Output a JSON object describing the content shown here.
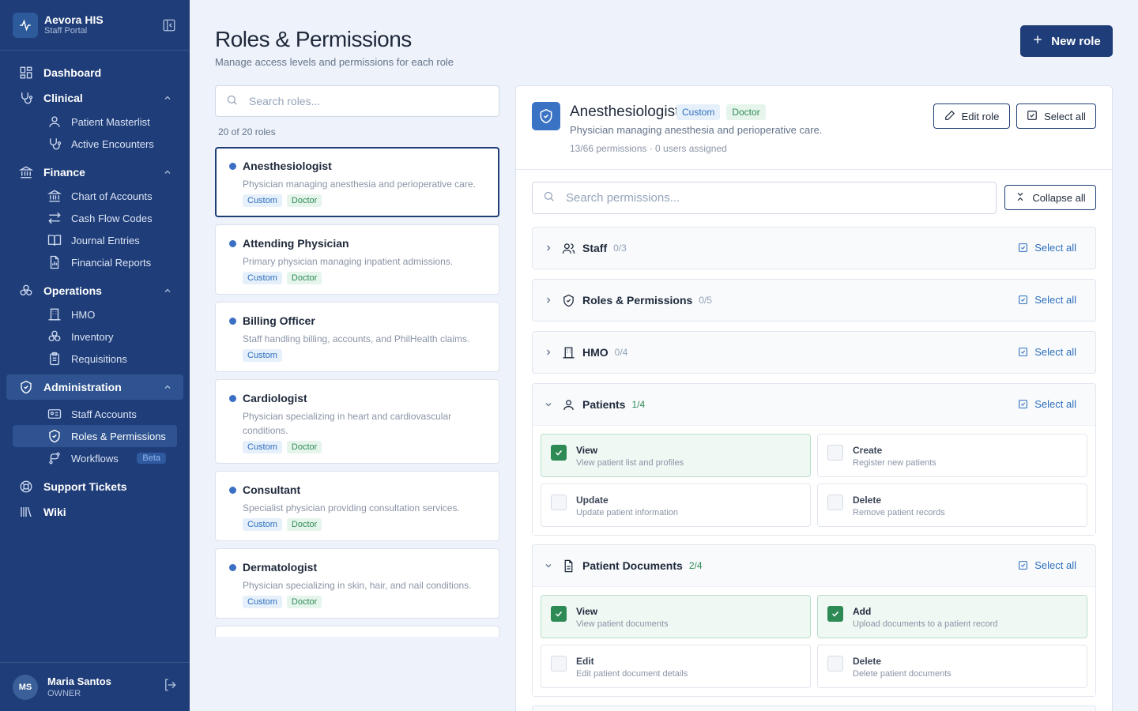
{
  "app": {
    "title": "Aevora HIS",
    "subtitle": "Staff Portal"
  },
  "sidebar": {
    "dashboard": "Dashboard",
    "clinical": {
      "label": "Clinical",
      "items": [
        "Patient Masterlist",
        "Active Encounters"
      ]
    },
    "finance": {
      "label": "Finance",
      "items": [
        "Chart of Accounts",
        "Cash Flow Codes",
        "Journal Entries",
        "Financial Reports"
      ]
    },
    "operations": {
      "label": "Operations",
      "items": [
        "HMO",
        "Inventory",
        "Requisitions"
      ]
    },
    "administration": {
      "label": "Administration",
      "items": [
        "Staff Accounts",
        "Roles & Permissions",
        "Workflows"
      ],
      "beta": "Beta"
    },
    "support": "Support Tickets",
    "wiki": "Wiki"
  },
  "user": {
    "initials": "MS",
    "name": "Maria Santos",
    "role": "OWNER"
  },
  "page": {
    "title": "Roles & Permissions",
    "subtitle": "Manage access levels and permissions for each role",
    "new_role": "New role"
  },
  "roles": {
    "search_placeholder": "Search roles...",
    "count": "20 of 20 roles",
    "items": [
      {
        "name": "Anesthesiologist",
        "desc": "Physician managing anesthesia and perioperative care.",
        "tags": [
          "Custom",
          "Doctor"
        ]
      },
      {
        "name": "Attending Physician",
        "desc": "Primary physician managing inpatient admissions.",
        "tags": [
          "Custom",
          "Doctor"
        ]
      },
      {
        "name": "Billing Officer",
        "desc": "Staff handling billing, accounts, and PhilHealth claims.",
        "tags": [
          "Custom"
        ]
      },
      {
        "name": "Cardiologist",
        "desc": "Physician specializing in heart and cardiovascular conditions.",
        "tags": [
          "Custom",
          "Doctor"
        ]
      },
      {
        "name": "Consultant",
        "desc": "Specialist physician providing consultation services.",
        "tags": [
          "Custom",
          "Doctor"
        ]
      },
      {
        "name": "Dermatologist",
        "desc": "Physician specializing in skin, hair, and nail conditions.",
        "tags": [
          "Custom",
          "Doctor"
        ]
      }
    ]
  },
  "detail": {
    "name": "Anesthesiologist",
    "tags": [
      "Custom",
      "Doctor"
    ],
    "desc": "Physician managing anesthesia and perioperative care.",
    "meta": "13/66 permissions · 0 users assigned",
    "edit_role": "Edit role",
    "select_all": "Select all",
    "search_placeholder": "Search permissions...",
    "collapse_all": "Collapse all",
    "modules": [
      {
        "name": "Staff",
        "count": "0/3"
      },
      {
        "name": "Roles & Permissions",
        "count": "0/5"
      },
      {
        "name": "HMO",
        "count": "0/4"
      },
      {
        "name": "Patients",
        "count": "1/4",
        "perms": [
          {
            "title": "View",
            "desc": "View patient list and profiles",
            "on": true
          },
          {
            "title": "Create",
            "desc": "Register new patients",
            "on": false
          },
          {
            "title": "Update",
            "desc": "Update patient information",
            "on": false
          },
          {
            "title": "Delete",
            "desc": "Remove patient records",
            "on": false
          }
        ]
      },
      {
        "name": "Patient Documents",
        "count": "2/4",
        "perms": [
          {
            "title": "View",
            "desc": "View patient documents",
            "on": true
          },
          {
            "title": "Add",
            "desc": "Upload documents to a patient record",
            "on": true
          },
          {
            "title": "Edit",
            "desc": "Edit patient document details",
            "on": false
          },
          {
            "title": "Delete",
            "desc": "Delete patient documents",
            "on": false
          }
        ]
      }
    ],
    "module_select_all": "Select all"
  }
}
